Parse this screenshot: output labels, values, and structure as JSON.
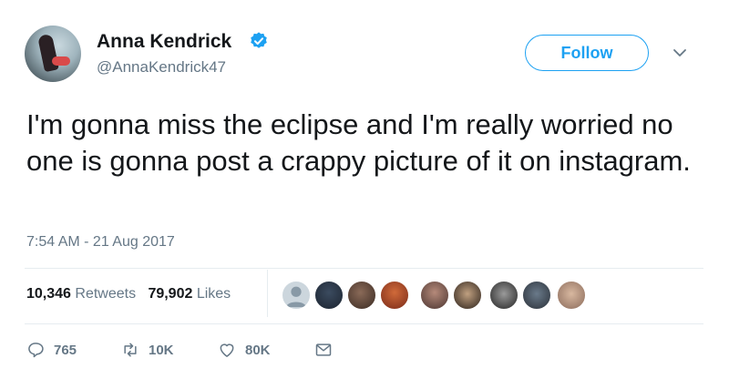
{
  "author": {
    "name": "Anna Kendrick",
    "handle": "@AnnaKendrick47",
    "verified_icon": "verified-badge-icon"
  },
  "follow_button": {
    "label": "Follow"
  },
  "tweet": {
    "text": "I'm gonna miss the eclipse and I'm really worried no one is gonna post a crappy picture of it on instagram.",
    "timestamp": "7:54 AM - 21 Aug 2017"
  },
  "stats": {
    "retweets_count": "10,346",
    "retweets_label": "Retweets",
    "likes_count": "79,902",
    "likes_label": "Likes"
  },
  "actions": {
    "reply_count": "765",
    "retweet_count": "10K",
    "like_count": "80K"
  },
  "colors": {
    "accent": "#1da1f2",
    "secondary_text": "#657786",
    "divider": "#e6ecf0"
  }
}
